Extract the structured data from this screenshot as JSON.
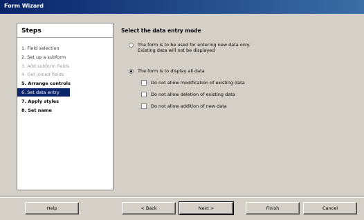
{
  "window": {
    "title": "Form Wizard"
  },
  "steps": {
    "title": "Steps",
    "items": [
      {
        "label": "1. Field selection",
        "state": "done"
      },
      {
        "label": "2. Set up a subform",
        "state": "done"
      },
      {
        "label": "3. Add subform fields",
        "state": "disabled"
      },
      {
        "label": "4. Get joined fields",
        "state": "disabled"
      },
      {
        "label": "5. Arrange controls",
        "state": "pending"
      },
      {
        "label": "6. Set data entry",
        "state": "current"
      },
      {
        "label": "7. Apply styles",
        "state": "pending"
      },
      {
        "label": "8. Set name",
        "state": "pending"
      }
    ]
  },
  "main": {
    "heading": "Select the data entry mode",
    "option_new_only": {
      "line1": "The form is to be used for entering new data only.",
      "line2": "Existing data will not be displayed",
      "selected": false
    },
    "option_display_all": {
      "label": "The form is to display all data",
      "selected": true
    },
    "checks": [
      {
        "label": "Do not allow modification of existing data",
        "checked": false
      },
      {
        "label": "Do not allow deletion of existing data",
        "checked": false
      },
      {
        "label": "Do not allow addition of new data",
        "checked": false
      }
    ]
  },
  "buttons": {
    "help": "Help",
    "back": "< Back",
    "next": "Next >",
    "finish": "Finish",
    "cancel": "Cancel"
  }
}
